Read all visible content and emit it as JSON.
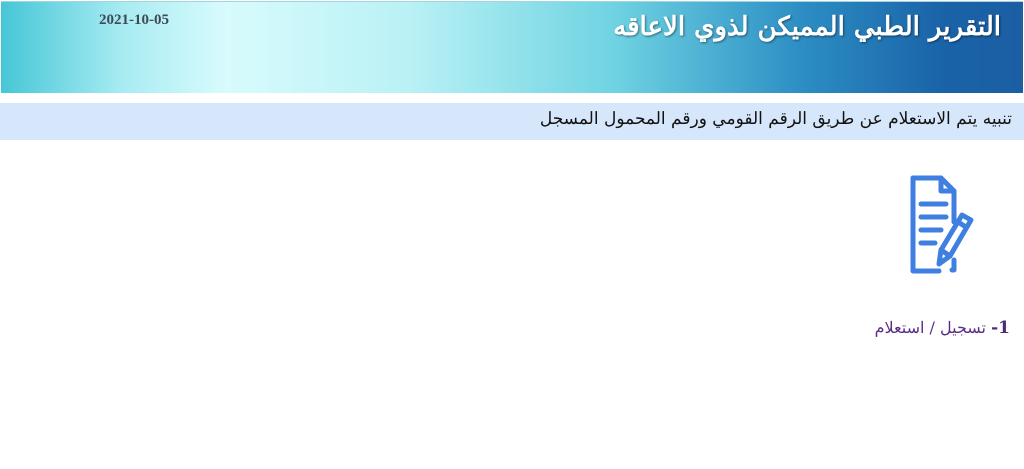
{
  "header": {
    "title": "التقرير الطبي المميكن لذوي الاعاقه",
    "date": "2021-10-05",
    "colors": {
      "gradient_light": "#d8fbfd",
      "gradient_dark": "#1b5ea3"
    }
  },
  "notice": {
    "text": "تنبيه يتم الاستعلام عن طريق الرقم القومي ورقم المحمول المسجل",
    "background": "#d6e6fb"
  },
  "registration_icon": {
    "icon": "document-pen-icon",
    "color": "#3f7fe0"
  },
  "menu": {
    "items": [
      {
        "number": "1-",
        "label": "تسجيل / استعلام"
      }
    ],
    "link_color": "#5a2d86"
  }
}
